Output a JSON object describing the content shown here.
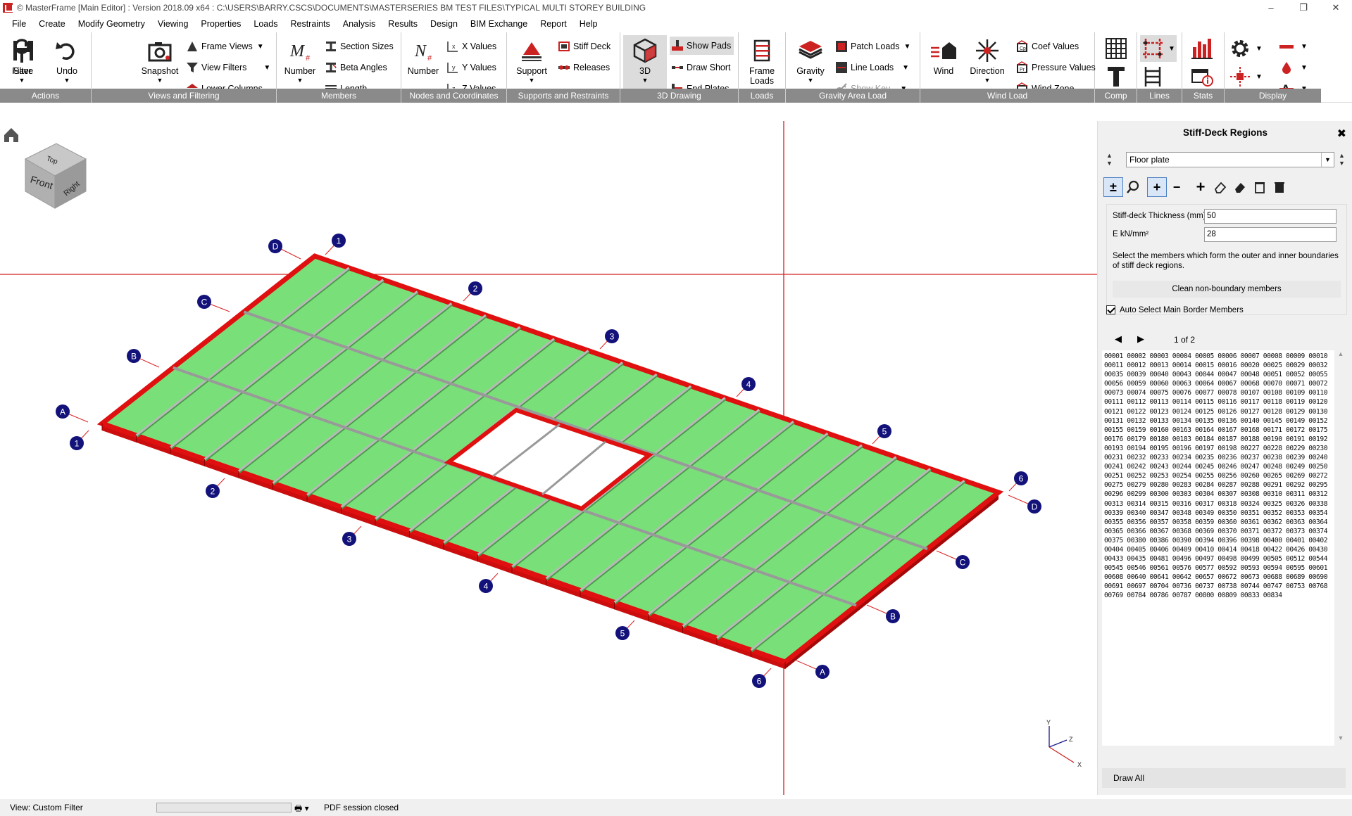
{
  "title": "© MasterFrame [Main Editor] : Version 2018.09 x64 : C:\\USERS\\BARRY.CSCS\\DOCUMENTS\\MASTERSERIES BM TEST FILES\\TYPICAL MULTI STOREY BUILDING",
  "window": {
    "minimize": "–",
    "restore": "❐",
    "close": "✕"
  },
  "menu": [
    "File",
    "Create",
    "Modify Geometry",
    "Viewing",
    "Properties",
    "Loads",
    "Restraints",
    "Analysis",
    "Results",
    "Design",
    "BIM Exchange",
    "Report",
    "Help"
  ],
  "ribbon": {
    "actions": {
      "label": "Actions",
      "save": "Save",
      "undo": "Undo"
    },
    "views": {
      "label": "Views and Filtering",
      "filter": "Filter",
      "snapshot": "Snapshot",
      "frame_views": "Frame Views",
      "view_filters": "View Filters",
      "lower_columns": "Lower Columns"
    },
    "members": {
      "label": "Members",
      "number": "Number",
      "section_sizes": "Section Sizes",
      "beta_angles": "Beta Angles",
      "length": "Length"
    },
    "nodes": {
      "label": "Nodes and Coordinates",
      "number": "Number",
      "x_values": "X Values",
      "y_values": "Y Values",
      "z_values": "Z Values"
    },
    "supports": {
      "label": "Supports and Restraints",
      "support": "Support",
      "stiff_deck": "Stiff Deck",
      "releases": "Releases"
    },
    "drawing": {
      "label": "3D Drawing",
      "three_d": "3D",
      "show_pads": "Show Pads",
      "draw_short": "Draw Short",
      "end_plates": "End Plates"
    },
    "loads": {
      "label": "Loads",
      "frame_loads_1": "Frame",
      "frame_loads_2": "Loads"
    },
    "gravity": {
      "label": "Gravity Area Load",
      "gravity": "Gravity",
      "patch_loads": "Patch Loads",
      "line_loads": "Line Loads",
      "show_key": "Show Key"
    },
    "wind": {
      "label": "Wind Load",
      "wind": "Wind",
      "direction": "Direction",
      "coef_values": "Coef Values",
      "pressure_values": "Pressure Values",
      "wind_zone": "Wind Zone"
    },
    "comp": {
      "label": "Comp"
    },
    "lines": {
      "label": "Lines"
    },
    "stats": {
      "label": "Stats"
    },
    "display": {
      "label": "Display"
    }
  },
  "viewcube": {
    "top": "Top",
    "front": "Front",
    "right": "Right"
  },
  "axis_triad": {
    "x": "X",
    "y": "Y",
    "z": "Z"
  },
  "grid_labels": {
    "letters": [
      "D",
      "C",
      "B",
      "A",
      "D",
      "C",
      "B",
      "A"
    ],
    "numbers": [
      "1",
      "2",
      "3",
      "4",
      "5",
      "6",
      "1",
      "2",
      "3",
      "4",
      "5",
      "6"
    ]
  },
  "colors": {
    "deck": "#79e079",
    "beam_red": "#e01010",
    "ribbon_label_bg": "#8a8a8a",
    "grid_node": "#12127a",
    "crosshair": "#d22020"
  },
  "panel": {
    "title": "Stiff-Deck Regions",
    "close": "✖",
    "region_value": "Floor plate",
    "thickness_label": "Stiff-deck Thickness (mm)",
    "thickness_value": "50",
    "e_label": "E kN/mm²",
    "e_value": "28",
    "help": "Select the members which form the outer and inner boundaries of stiff deck regions.",
    "clean_button": "Clean non-boundary members",
    "auto_select_label": "Auto Select Main Border Members",
    "page_text": "1 of 2",
    "members": "00001 00002 00003 00004 00005 00006 00007 00008 00009 00010 00011 00012 00013 00014 00015 00016 00020 00025 00029 00032 00035 00039 00040 00043 00044 00047 00048 00051 00052 00055 00056 00059 00060 00063 00064 00067 00068 00070 00071 00072 00073 00074 00075 00076 00077 00078 00107 00108 00109 00110 00111 00112 00113 00114 00115 00116 00117 00118 00119 00120 00121 00122 00123 00124 00125 00126 00127 00128 00129 00130 00131 00132 00133 00134 00135 00136 00140 00145 00149 00152 00155 00159 00160 00163 00164 00167 00168 00171 00172 00175 00176 00179 00180 00183 00184 00187 00188 00190 00191 00192 00193 00194 00195 00196 00197 00198 00227 00228 00229 00230 00231 00232 00233 00234 00235 00236 00237 00238 00239 00240 00241 00242 00243 00244 00245 00246 00247 00248 00249 00250 00251 00252 00253 00254 00255 00256 00260 00265 00269 00272 00275 00279 00280 00283 00284 00287 00288 00291 00292 00295 00296 00299 00300 00303 00304 00307 00308 00310 00311 00312 00313 00314 00315 00316 00317 00318 00324 00325 00326 00338 00339 00340 00347 00348 00349 00350 00351 00352 00353 00354 00355 00356 00357 00358 00359 00360 00361 00362 00363 00364 00365 00366 00367 00368 00369 00370 00371 00372 00373 00374 00375 00380 00386 00390 00394 00396 00398 00400 00401 00402 00404 00405 00406 00409 00410 00414 00418 00422 00426 00430 00433 00435 00481 00496 00497 00498 00499 00505 00512 00544 00545 00546 00561 00576 00577 00592 00593 00594 00595 00601 00608 00640 00641 00642 00657 00672 00673 00688 00689 00690 00691 00697 00704 00736 00737 00738 00744 00747 00753 00768 00769 00784 00786 00787 00800 00809 00833 00834",
    "draw_all": "Draw All"
  },
  "status": {
    "view": "View: Custom Filter",
    "pdf": "PDF session closed"
  }
}
